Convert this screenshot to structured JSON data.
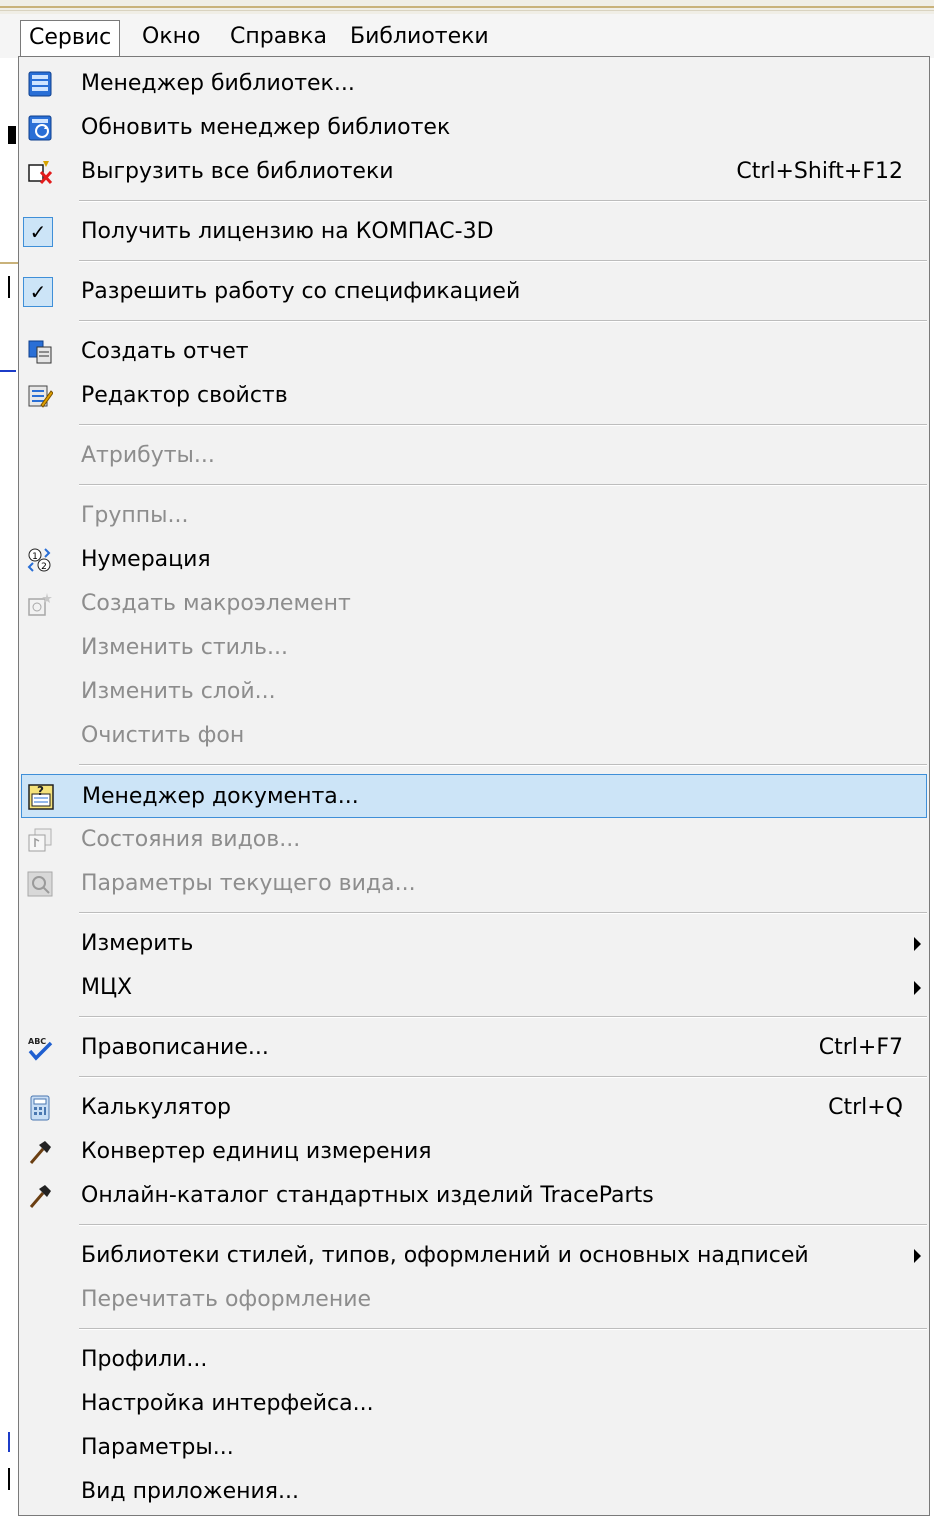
{
  "menubar": {
    "items": [
      {
        "label": "Сервис",
        "active": true
      },
      {
        "label": "Окно",
        "active": false
      },
      {
        "label": "Справка",
        "active": false
      },
      {
        "label": "Библиотеки",
        "active": false
      }
    ]
  },
  "menu": {
    "items": [
      {
        "label": "Менеджер библиотек...",
        "icon": "library-manager-icon",
        "enabled": true
      },
      {
        "label": "Обновить менеджер библиотек",
        "icon": "refresh-library-icon",
        "enabled": true
      },
      {
        "label": "Выгрузить все библиотеки",
        "icon": "unload-libraries-icon",
        "enabled": true,
        "shortcut": "Ctrl+Shift+F12"
      },
      {
        "label": "Получить лицензию на КОМПАС-3D",
        "icon": "check-icon",
        "checked": true,
        "enabled": true
      },
      {
        "label": "Разрешить работу со спецификацией",
        "icon": "check-icon",
        "checked": true,
        "enabled": true
      },
      {
        "label": "Создать отчет",
        "icon": "report-icon",
        "enabled": true
      },
      {
        "label": "Редактор свойств",
        "icon": "properties-editor-icon",
        "enabled": true
      },
      {
        "label": "Атрибуты...",
        "enabled": false
      },
      {
        "label": "Группы...",
        "enabled": false
      },
      {
        "label": "Нумерация",
        "icon": "numbering-icon",
        "enabled": true
      },
      {
        "label": "Создать макроэлемент",
        "icon": "macro-element-icon",
        "enabled": false
      },
      {
        "label": "Изменить стиль...",
        "enabled": false
      },
      {
        "label": "Изменить слой...",
        "enabled": false
      },
      {
        "label": "Очистить фон",
        "enabled": false
      },
      {
        "label": "Менеджер документа...",
        "icon": "document-manager-icon",
        "enabled": true,
        "highlighted": true
      },
      {
        "label": "Состояния видов...",
        "icon": "view-states-icon",
        "enabled": false
      },
      {
        "label": "Параметры текущего вида...",
        "icon": "view-params-icon",
        "enabled": false
      },
      {
        "label": "Измерить",
        "enabled": true,
        "submenu": true
      },
      {
        "label": "МЦХ",
        "enabled": true,
        "submenu": true
      },
      {
        "label": "Правописание...",
        "icon": "spellcheck-icon",
        "enabled": true,
        "shortcut": "Ctrl+F7"
      },
      {
        "label": "Калькулятор",
        "icon": "calculator-icon",
        "enabled": true,
        "shortcut": "Ctrl+Q"
      },
      {
        "label": "Конвертер единиц измерения",
        "icon": "hammer-icon",
        "enabled": true
      },
      {
        "label": "Онлайн-каталог стандартных изделий TraceParts",
        "icon": "hammer-icon",
        "enabled": true
      },
      {
        "label": "Библиотеки стилей, типов, оформлений и основных надписей",
        "enabled": true,
        "submenu": true
      },
      {
        "label": "Перечитать оформление",
        "enabled": false
      },
      {
        "label": "Профили...",
        "enabled": true
      },
      {
        "label": "Настройка интерфейса...",
        "enabled": true
      },
      {
        "label": "Параметры...",
        "enabled": true
      },
      {
        "label": "Вид приложения...",
        "enabled": true
      }
    ]
  }
}
